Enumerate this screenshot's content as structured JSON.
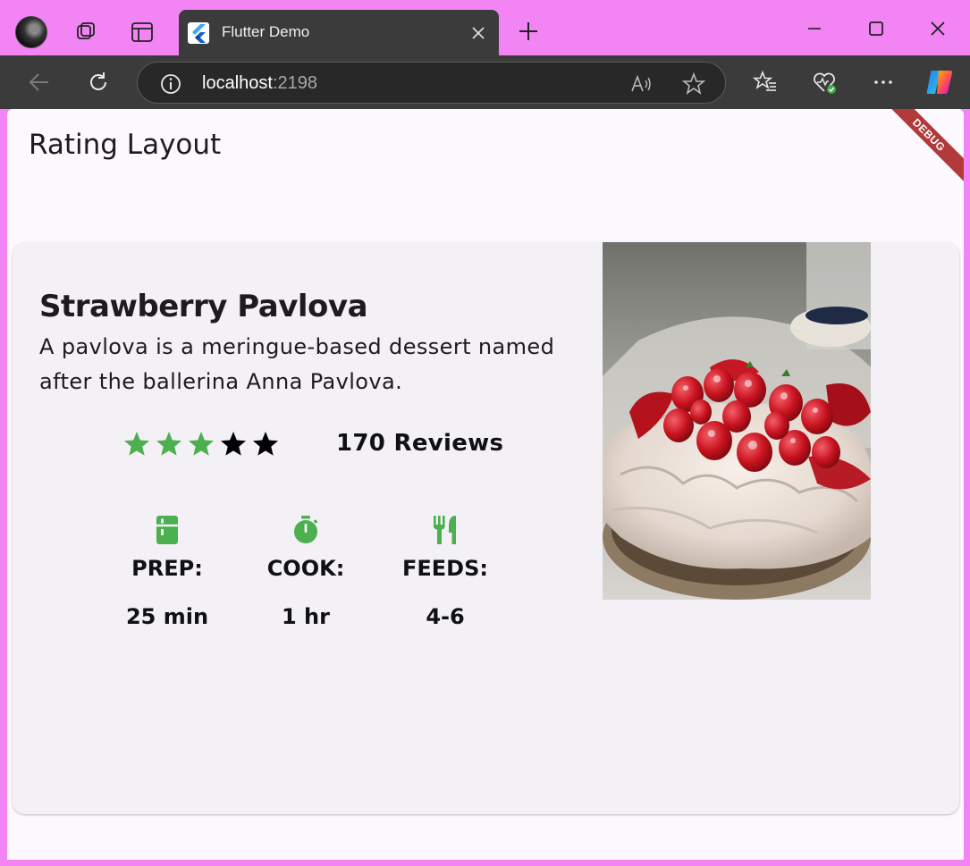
{
  "browser": {
    "tab_title": "Flutter Demo",
    "address_host": "localhost",
    "address_port": ":2198"
  },
  "app": {
    "title": "Rating Layout",
    "debug_banner": "DEBUG"
  },
  "recipe": {
    "title": "Strawberry Pavlova",
    "description": "A pavlova is a meringue-based dessert named after the ballerina Anna Pavlova.",
    "rating": {
      "filled": 3,
      "total": 5,
      "filled_color": "#4caf50",
      "empty_color": "#000000"
    },
    "reviews": "170 Reviews",
    "info": [
      {
        "icon": "kitchen-icon",
        "label": "PREP:",
        "value": "25 min"
      },
      {
        "icon": "timer-icon",
        "label": "COOK:",
        "value": "1 hr"
      },
      {
        "icon": "restaurant-icon",
        "label": "FEEDS:",
        "value": "4-6"
      }
    ],
    "accent_color": "#4caf50"
  }
}
